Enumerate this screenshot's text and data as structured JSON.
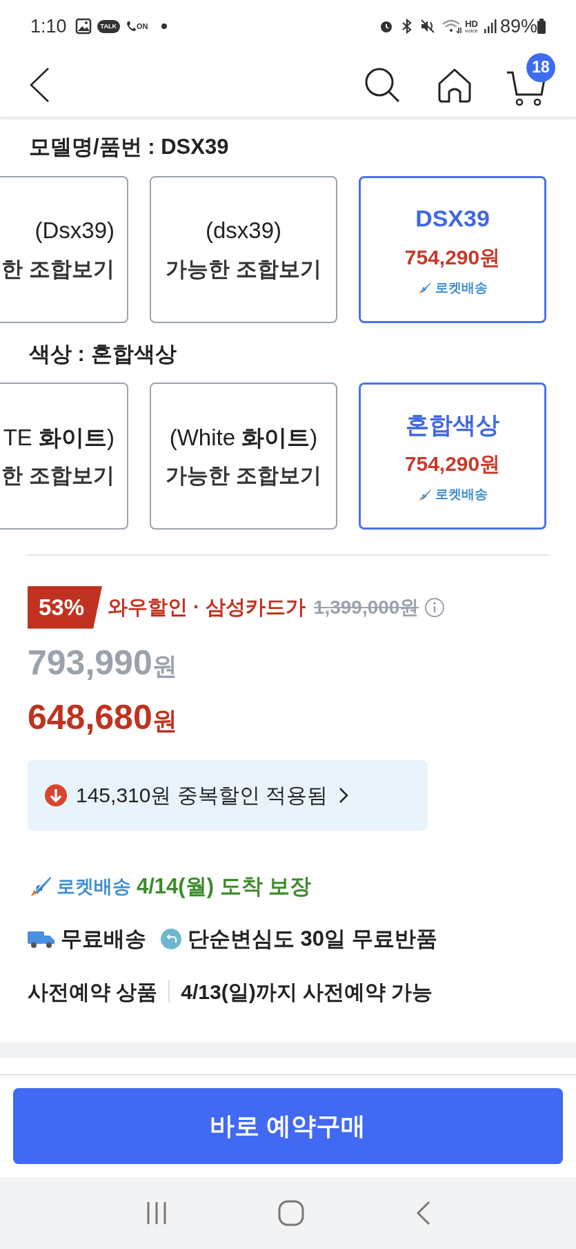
{
  "status_bar": {
    "time": "1:10",
    "talk_badge": "TALK",
    "call_badge": "ON",
    "hd_label": "HD",
    "voice_label": "voice",
    "battery": "89%"
  },
  "header": {
    "cart_count": "18"
  },
  "options": [
    {
      "label": "모델명/품번 : DSX39",
      "choices": [
        {
          "kind": "combo",
          "title": "(Dsx39)",
          "subtitle": "한 조합보기",
          "selected": false
        },
        {
          "kind": "combo",
          "title": "(dsx39)",
          "subtitle": "가능한 조합보기",
          "selected": false
        },
        {
          "kind": "price",
          "title": "DSX39",
          "price": "754,290원",
          "delivery": "로켓배송",
          "selected": true
        }
      ]
    },
    {
      "label": "색상 : 혼합색상",
      "choices": [
        {
          "kind": "combo",
          "title": "TE **화이트**)",
          "subtitle": "한 조합보기",
          "selected": false
        },
        {
          "kind": "combo",
          "title": "(White **화이트**)",
          "subtitle": "가능한 조합보기",
          "selected": false
        },
        {
          "kind": "price",
          "title": "혼합색상",
          "price": "754,290원",
          "delivery": "로켓배송",
          "selected": true
        }
      ]
    }
  ],
  "price": {
    "discount_badge": "53%",
    "discount_label": "와우할인 · 삼성카드가",
    "original_price": "1,399,000원",
    "sale_price": {
      "amount": "793,990",
      "unit": "원"
    },
    "card_price": {
      "amount": "648,680",
      "unit": "원"
    },
    "coupon": "145,310원 중복할인 적용됨"
  },
  "delivery": {
    "rocket_label": "로켓배송",
    "arrival": "4/14(월) 도착 보장"
  },
  "benefits": [
    {
      "kind": "shipping",
      "text": "무료배송"
    },
    {
      "kind": "return",
      "text": "단순변심도 30일 무료반품"
    }
  ],
  "preorder": {
    "label": "사전예약 상품",
    "text": "4/13(일)까지 사전예약 가능"
  },
  "buy_button": "바로 예약구매"
}
